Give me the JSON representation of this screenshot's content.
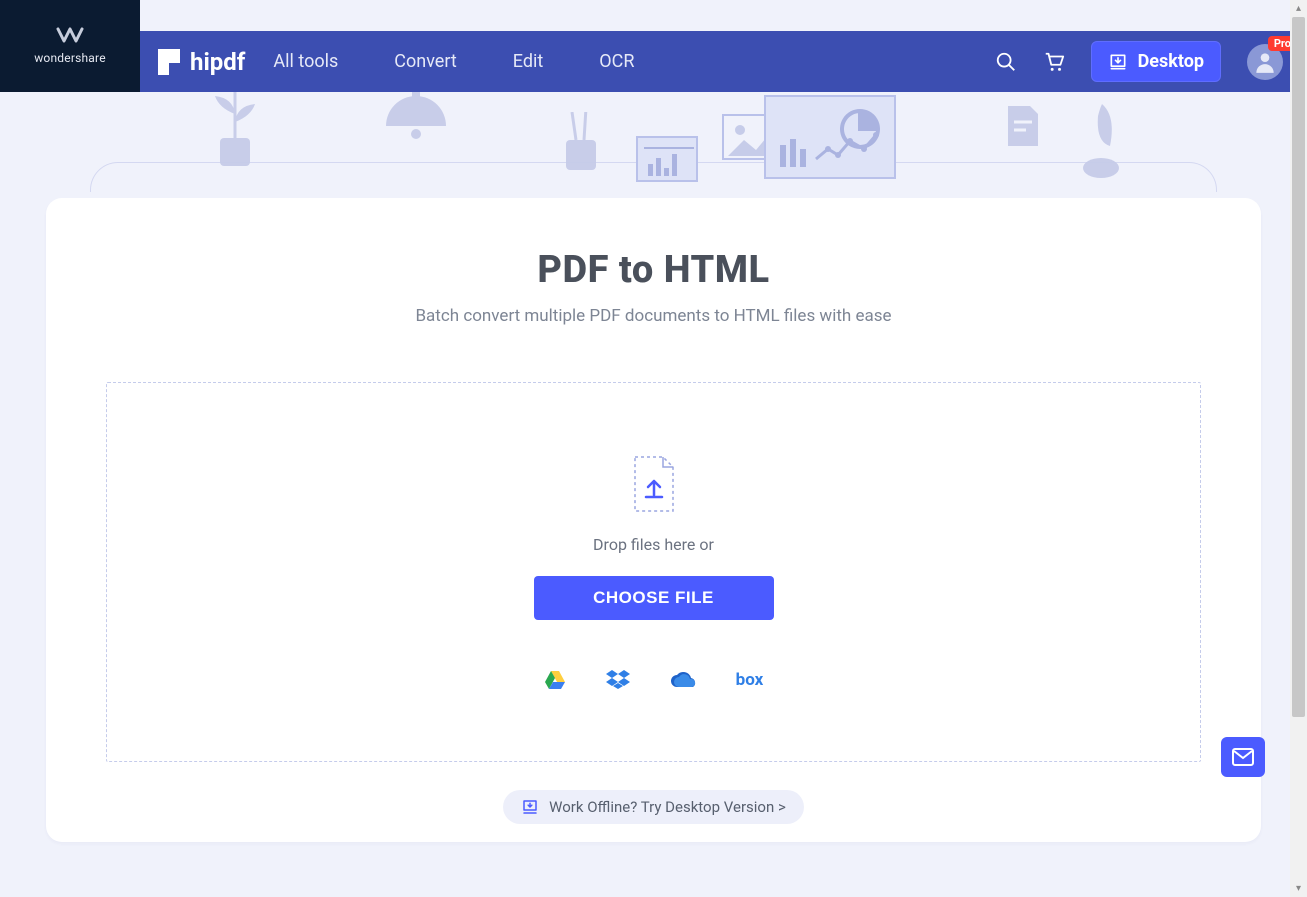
{
  "brand": {
    "name": "wondershare"
  },
  "logo": {
    "text": "hipdf"
  },
  "nav": {
    "items": [
      {
        "label": "All tools"
      },
      {
        "label": "Convert"
      },
      {
        "label": "Edit"
      },
      {
        "label": "OCR"
      }
    ],
    "desktop_label": "Desktop",
    "pro_badge": "Pro"
  },
  "page": {
    "title": "PDF to HTML",
    "subtitle": "Batch convert multiple PDF documents to HTML files with ease"
  },
  "dropzone": {
    "drop_text": "Drop files here or",
    "choose_label": "CHOOSE FILE"
  },
  "cloud_providers": {
    "box_label": "box"
  },
  "offline": {
    "label": "Work Offline? Try Desktop Version >"
  }
}
